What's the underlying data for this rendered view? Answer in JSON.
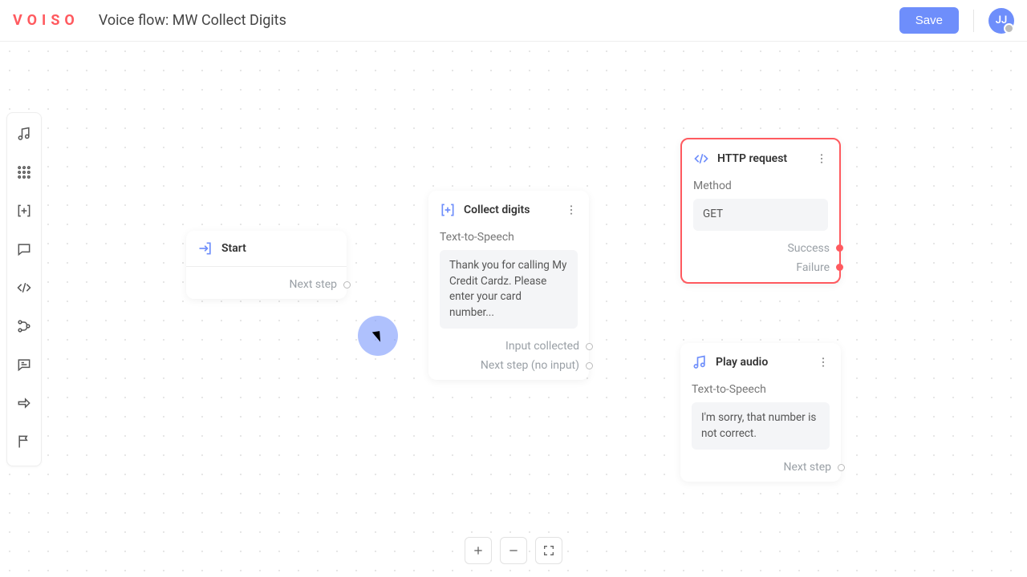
{
  "header": {
    "logo": "VOISO",
    "title": "Voice flow: MW Collect Digits",
    "save_label": "Save",
    "avatar_initials": "JJ"
  },
  "sidebar": {
    "items": [
      {
        "name": "play-audio-icon"
      },
      {
        "name": "keypad-icon"
      },
      {
        "name": "collect-digits-icon"
      },
      {
        "name": "message-icon"
      },
      {
        "name": "code-icon"
      },
      {
        "name": "branch-icon"
      },
      {
        "name": "voicemail-icon"
      },
      {
        "name": "forward-icon"
      },
      {
        "name": "flag-icon"
      }
    ]
  },
  "nodes": {
    "start": {
      "title": "Start",
      "outputs": [
        "Next step"
      ]
    },
    "collect": {
      "title": "Collect digits",
      "section": "Text-to-Speech",
      "value": "Thank you for calling My Credit Cardz. Please enter your card number...",
      "outputs": [
        "Input collected",
        "Next step (no input)"
      ]
    },
    "http": {
      "title": "HTTP request",
      "section": "Method",
      "value": "GET",
      "outputs": [
        "Success",
        "Failure"
      ]
    },
    "play": {
      "title": "Play audio",
      "section": "Text-to-Speech",
      "value": "I'm sorry, that number is not correct.",
      "outputs": [
        "Next step"
      ]
    }
  },
  "zoom": {
    "in": "+",
    "out": "−",
    "fit": "fit"
  }
}
